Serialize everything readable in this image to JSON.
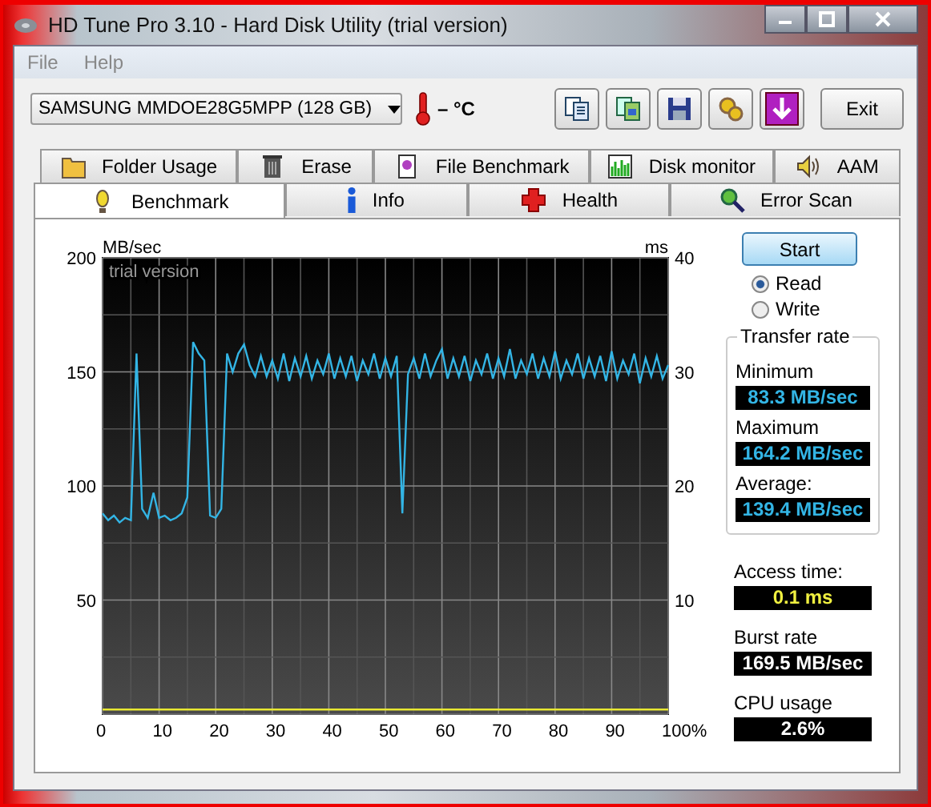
{
  "window": {
    "title": "HD Tune Pro 3.10 - Hard Disk Utility (trial version)"
  },
  "menu": [
    {
      "label": "File"
    },
    {
      "label": "Help"
    }
  ],
  "toolbar": {
    "drive": "SAMSUNG MMDOE28G5MPP (128 GB)",
    "temperature": "– °C",
    "exit": "Exit"
  },
  "tab_rows": [
    [
      {
        "label": "Folder Usage",
        "kind": "folder",
        "selected": false
      },
      {
        "label": "Erase",
        "kind": "trash",
        "selected": false
      },
      {
        "label": "File Benchmark",
        "kind": "file",
        "selected": false
      },
      {
        "label": "Disk monitor",
        "kind": "monitor",
        "selected": false
      },
      {
        "label": "AAM",
        "kind": "speaker",
        "selected": false
      }
    ],
    [
      {
        "label": "Benchmark",
        "kind": "bulb",
        "selected": true
      },
      {
        "label": "Info",
        "kind": "info",
        "selected": false
      },
      {
        "label": "Health",
        "kind": "cross",
        "selected": false
      },
      {
        "label": "Error Scan",
        "kind": "magnifier",
        "selected": false
      }
    ]
  ],
  "benchmark": {
    "chart_data": {
      "type": "line",
      "grid": true,
      "ylabel": "MB/sec",
      "xlim": [
        0,
        100
      ],
      "ylim": [
        0,
        200
      ],
      "xticks": [
        0,
        10,
        20,
        30,
        40,
        50,
        60,
        70,
        80,
        90,
        {
          "value": 100,
          "label": "100%"
        }
      ],
      "yticks": [
        50,
        100,
        150,
        200
      ],
      "x": [
        0,
        1,
        2,
        3,
        4,
        5,
        6,
        7,
        8,
        9,
        10,
        11,
        12,
        13,
        14,
        15,
        16,
        17,
        18,
        19,
        20,
        21,
        22,
        23,
        24,
        25,
        26,
        27,
        28,
        29,
        30,
        31,
        32,
        33,
        34,
        35,
        36,
        37,
        38,
        39,
        40,
        41,
        42,
        43,
        44,
        45,
        46,
        47,
        48,
        49,
        50,
        51,
        52,
        53,
        54,
        55,
        56,
        57,
        58,
        59,
        60,
        61,
        62,
        63,
        64,
        65,
        66,
        67,
        68,
        69,
        70,
        71,
        72,
        73,
        74,
        75,
        76,
        77,
        78,
        79,
        80,
        81,
        82,
        83,
        84,
        85,
        86,
        87,
        88,
        89,
        90,
        91,
        92,
        93,
        94,
        95,
        96,
        97,
        98,
        99,
        100
      ],
      "series": [
        {
          "color": "#33b5e5",
          "values": [
            88,
            85,
            87,
            84,
            86,
            85,
            158,
            90,
            86,
            97,
            86,
            87,
            85,
            86,
            88,
            95,
            163,
            158,
            155,
            87,
            86,
            90,
            158,
            150,
            158,
            162,
            153,
            148,
            157,
            148,
            155,
            147,
            158,
            146,
            156,
            148,
            157,
            147,
            155,
            149,
            158,
            147,
            156,
            148,
            157,
            146,
            155,
            149,
            158,
            147,
            156,
            148,
            157,
            88,
            149,
            156,
            147,
            158,
            148,
            155,
            160,
            147,
            156,
            148,
            157,
            146,
            155,
            149,
            158,
            147,
            156,
            148,
            160,
            147,
            155,
            149,
            158,
            147,
            156,
            148,
            159,
            147,
            155,
            149,
            158,
            147,
            156,
            148,
            157,
            146,
            159,
            147,
            155,
            149,
            158,
            145,
            156,
            148,
            157,
            147,
            153
          ]
        },
        {
          "color": "#e8e832",
          "values": [
            2,
            2,
            2,
            2,
            2,
            2,
            2,
            2,
            2,
            2,
            2,
            2,
            2,
            2,
            2,
            2,
            2,
            2,
            2,
            2,
            2,
            2,
            2,
            2,
            2,
            2,
            2,
            2,
            2,
            2,
            2,
            2,
            2,
            2,
            2,
            2,
            2,
            2,
            2,
            2,
            2,
            2,
            2,
            2,
            2,
            2,
            2,
            2,
            2,
            2,
            2,
            2,
            2,
            2,
            2,
            2,
            2,
            2,
            2,
            2,
            2,
            2,
            2,
            2,
            2,
            2,
            2,
            2,
            2,
            2,
            2,
            2,
            2,
            2,
            2,
            2,
            2,
            2,
            2,
            2,
            2,
            2,
            2,
            2,
            2,
            2,
            2,
            2,
            2,
            2,
            2,
            2,
            2,
            2,
            2,
            2,
            2,
            2,
            2,
            2,
            2
          ]
        }
      ]
    },
    "right_axis": {
      "label": "ms",
      "ticks": [
        "40",
        "30",
        "20",
        "10"
      ]
    },
    "watermark": "trial version",
    "start": "Start",
    "modes": [
      {
        "label": "Read",
        "selected": true
      },
      {
        "label": "Write",
        "selected": false
      }
    ],
    "transfer_rate": {
      "title": "Transfer rate",
      "stats": [
        {
          "label": "Minimum",
          "value": "83.3 MB/sec",
          "color": "#33b5e5"
        },
        {
          "label": "Maximum",
          "value": "164.2 MB/sec",
          "color": "#33b5e5"
        },
        {
          "label": "Average:",
          "value": "139.4 MB/sec",
          "color": "#33b5e5"
        }
      ]
    },
    "stats": [
      {
        "label": "Access time:",
        "value": "0.1 ms",
        "color": "#f0f040"
      },
      {
        "label": "Burst rate",
        "value": "169.5 MB/sec",
        "color": "#ffffff"
      },
      {
        "label": "CPU usage",
        "value": "2.6%",
        "color": "#ffffff"
      }
    ]
  }
}
